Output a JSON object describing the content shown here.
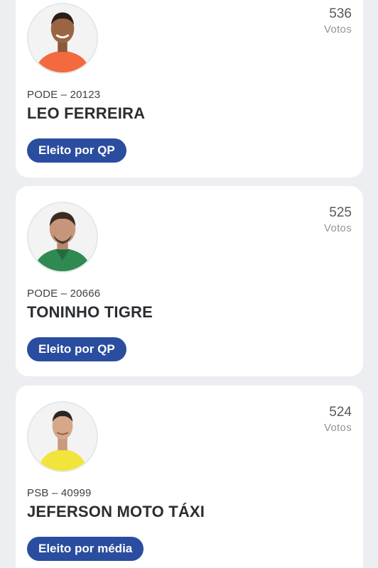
{
  "candidates": [
    {
      "party": "PODE – 20123",
      "name": "LEO FERREIRA",
      "votes": "536",
      "votes_label": "Votos",
      "status": "Eleito por QP",
      "shirt_color": "#f26a3d"
    },
    {
      "party": "PODE – 20666",
      "name": "TONINHO TIGRE",
      "votes": "525",
      "votes_label": "Votos",
      "status": "Eleito por QP",
      "shirt_color": "#2f8a52"
    },
    {
      "party": "PSB – 40999",
      "name": "JEFERSON MOTO TÁXI",
      "votes": "524",
      "votes_label": "Votos",
      "status": "Eleito por média",
      "shirt_color": "#f1e43a"
    }
  ],
  "colors": {
    "background": "#eceef1",
    "card": "#ffffff",
    "badge": "#2a4d9f",
    "name_text": "#2a2d31"
  }
}
